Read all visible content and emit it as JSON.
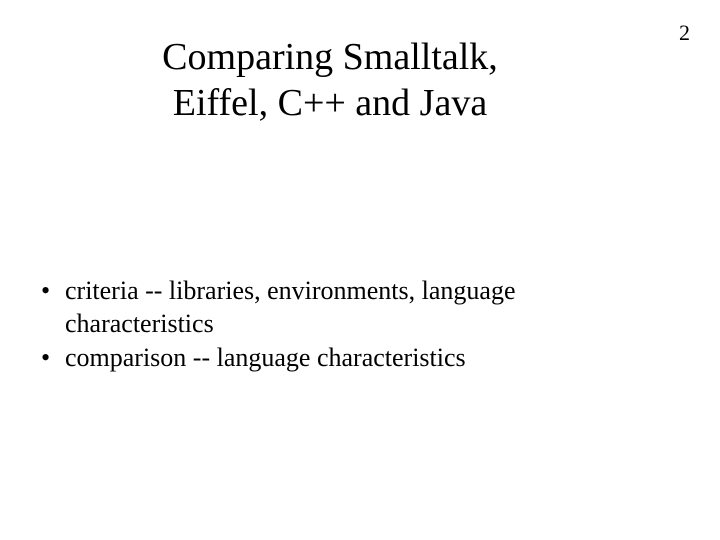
{
  "page_number": "2",
  "title": "Comparing Smalltalk, Eiffel, C++ and Java",
  "bullets": [
    "criteria -- libraries, environments, language characteristics",
    "comparison -- language characteristics"
  ]
}
